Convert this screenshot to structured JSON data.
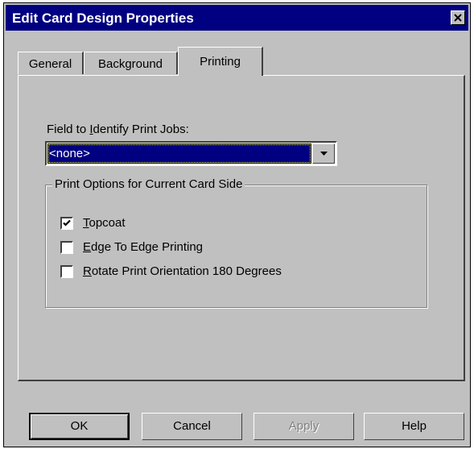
{
  "window": {
    "title": "Edit Card Design Properties",
    "close_icon": "close-icon"
  },
  "tabs": [
    {
      "label": "General",
      "active": false
    },
    {
      "label": "Background",
      "active": false
    },
    {
      "label": "Printing",
      "active": true
    }
  ],
  "printing": {
    "field_label_prefix": "Field to ",
    "field_label_accel": "I",
    "field_label_suffix": "dentify Print Jobs:",
    "field_value": "<none>",
    "group_title": "Print Options for Current Card Side",
    "options": [
      {
        "accel": "T",
        "rest": "opcoat",
        "checked": true
      },
      {
        "accel": "E",
        "rest": "dge To Edge Printing",
        "checked": false
      },
      {
        "accel": "R",
        "rest": "otate Print Orientation 180 Degrees",
        "checked": false
      }
    ]
  },
  "buttons": {
    "ok": "OK",
    "cancel": "Cancel",
    "apply": "Apply",
    "help": "Help"
  },
  "colors": {
    "title_bar": "#000080",
    "dialog_face": "#c0c0c0",
    "selection": "#000080"
  }
}
